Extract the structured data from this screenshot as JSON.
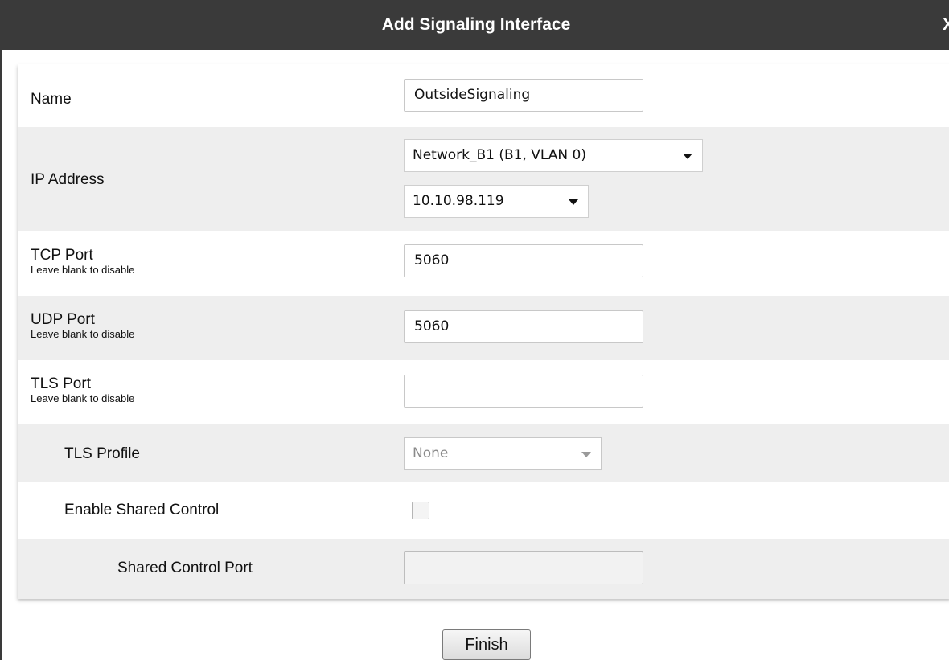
{
  "dialog": {
    "title": "Add Signaling Interface",
    "close_label": "X"
  },
  "fields": {
    "name": {
      "label": "Name",
      "value": "OutsideSignaling"
    },
    "ip_address": {
      "label": "IP Address",
      "network_value": "Network_B1 (B1, VLAN 0)",
      "ip_value": "10.10.98.119"
    },
    "tcp_port": {
      "label": "TCP Port",
      "hint": "Leave blank to disable",
      "value": "5060"
    },
    "udp_port": {
      "label": "UDP Port",
      "hint": "Leave blank to disable",
      "value": "5060"
    },
    "tls_port": {
      "label": "TLS Port",
      "hint": "Leave blank to disable",
      "value": ""
    },
    "tls_profile": {
      "label": "TLS Profile",
      "value": "None"
    },
    "enable_shared_control": {
      "label": "Enable Shared Control",
      "checked": false
    },
    "shared_control_port": {
      "label": "Shared Control Port",
      "value": ""
    }
  },
  "actions": {
    "finish_label": "Finish"
  },
  "colors": {
    "titlebar": "#3a3a3a",
    "alt_row": "#eeeeee"
  }
}
